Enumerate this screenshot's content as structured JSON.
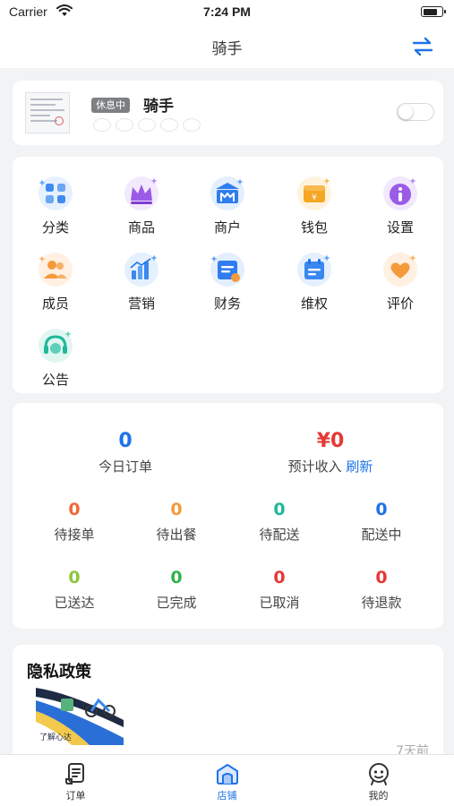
{
  "status_bar": {
    "carrier": "Carrier",
    "time": "7:24 PM",
    "battery_level": 0.75
  },
  "nav": {
    "title": "骑手",
    "switch_icon": "switch-arrows-icon"
  },
  "profile": {
    "status_badge": "休息中",
    "name": "骑手",
    "rating_stars": 5,
    "online_toggle": false
  },
  "menu": [
    {
      "label": "分类",
      "icon": "category-icon",
      "color": "#3f8cf0"
    },
    {
      "label": "商品",
      "icon": "crown-icon",
      "color": "#9b5be6"
    },
    {
      "label": "商户",
      "icon": "merchant-icon",
      "color": "#2f7df0"
    },
    {
      "label": "钱包",
      "icon": "wallet-icon",
      "color": "#f5a623"
    },
    {
      "label": "设置",
      "icon": "settings-info-icon",
      "color": "#9b5be6"
    },
    {
      "label": "成员",
      "icon": "members-icon",
      "color": "#f59a3b"
    },
    {
      "label": "营销",
      "icon": "marketing-chart-icon",
      "color": "#3a88f0"
    },
    {
      "label": "财务",
      "icon": "finance-icon",
      "color": "#2f7df0"
    },
    {
      "label": "维权",
      "icon": "rights-calendar-icon",
      "color": "#3a88f0"
    },
    {
      "label": "评价",
      "icon": "heart-review-icon",
      "color": "#f59a3b"
    },
    {
      "label": "公告",
      "icon": "announcement-icon",
      "color": "#1fb89a"
    }
  ],
  "stats": {
    "today_orders": {
      "value": "0",
      "label": "今日订单",
      "color": "#1e73e8"
    },
    "expected_income": {
      "value": "¥0",
      "label": "预计收入",
      "refresh": "刷新",
      "color": "#e53935"
    },
    "order_states": [
      {
        "value": "0",
        "label": "待接单",
        "color": "#f0683a"
      },
      {
        "value": "0",
        "label": "待出餐",
        "color": "#f59a3b"
      },
      {
        "value": "0",
        "label": "待配送",
        "color": "#1fb89a"
      },
      {
        "value": "0",
        "label": "配送中",
        "color": "#1e73e8"
      },
      {
        "value": "0",
        "label": "已送达",
        "color": "#8cc63f"
      },
      {
        "value": "0",
        "label": "已完成",
        "color": "#2fb24c"
      },
      {
        "value": "0",
        "label": "已取消",
        "color": "#e53935"
      },
      {
        "value": "0",
        "label": "待退款",
        "color": "#e53935"
      }
    ]
  },
  "privacy": {
    "title": "隐私政策",
    "image_caption": "了解心达",
    "time": "7天前"
  },
  "tabs": [
    {
      "label": "订单",
      "icon": "orders-icon",
      "active": false
    },
    {
      "label": "店铺",
      "icon": "shop-icon",
      "active": true
    },
    {
      "label": "我的",
      "icon": "profile-face-icon",
      "active": false
    }
  ],
  "colors": {
    "accent": "#1e73e8",
    "background": "#f2f3f5"
  }
}
